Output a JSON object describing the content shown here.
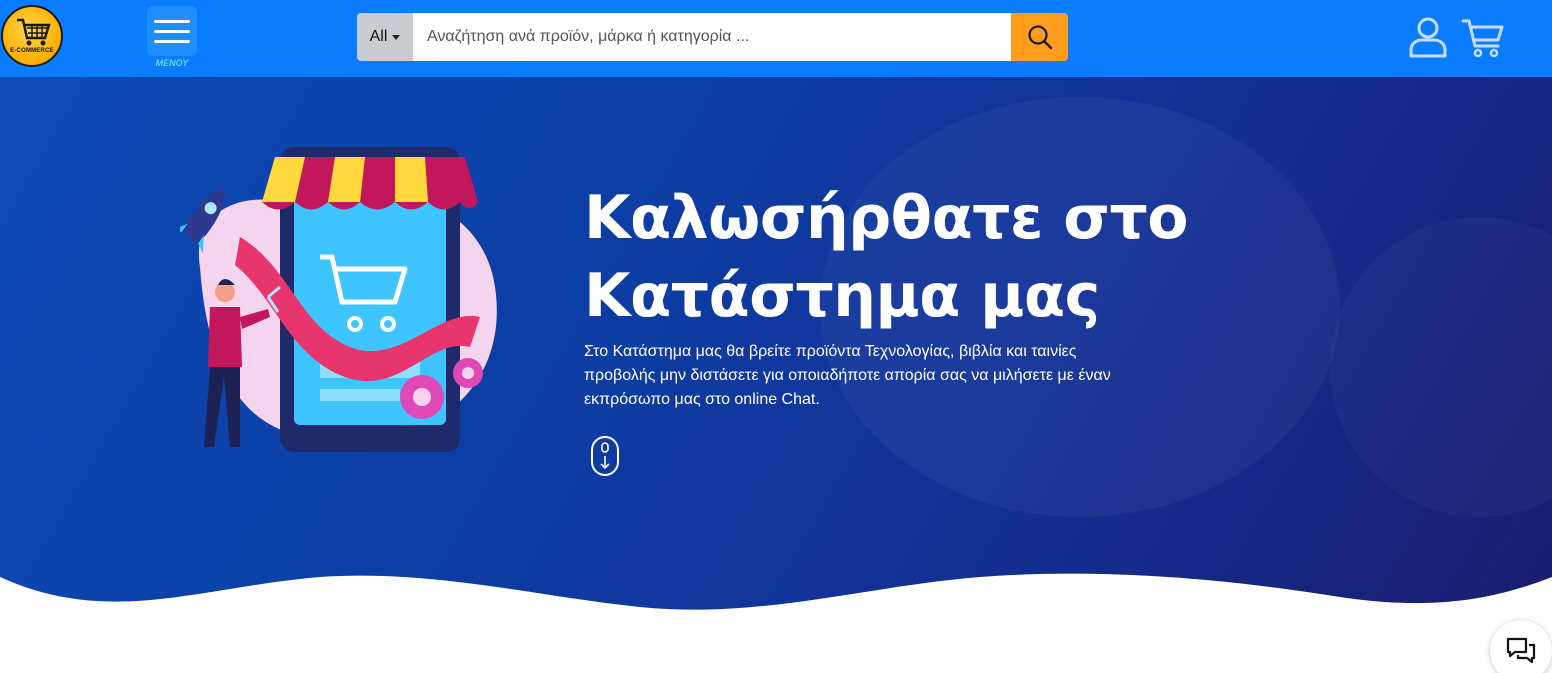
{
  "header": {
    "logo_text": "E-COMMERCE",
    "menu_label": "ΜΕΝΟΥ",
    "search": {
      "category": "All",
      "placeholder": "Αναζήτηση ανά προϊόν, μάρκα ή κατηγορία ..."
    },
    "icons": [
      "search-icon",
      "user-icon",
      "cart-icon",
      "menu-icon"
    ]
  },
  "hero": {
    "title": "Καλωσήρθατε στο Κατάστημα μας",
    "description": "Στο Κατάστημα μας θα βρείτε προϊόντα Τεχνολογίας, βιβλία και ταινίες προβολής μην διστάσετε για οποιαδήποτε απορία σας να μιλήσετε με έναν εκπρόσωπο μας στο online Chat."
  },
  "colors": {
    "navbar": "#0a7cff",
    "search_button": "#ff9d1f",
    "hero_background": "#0c3fa5",
    "hero_text": "#ffffff"
  }
}
